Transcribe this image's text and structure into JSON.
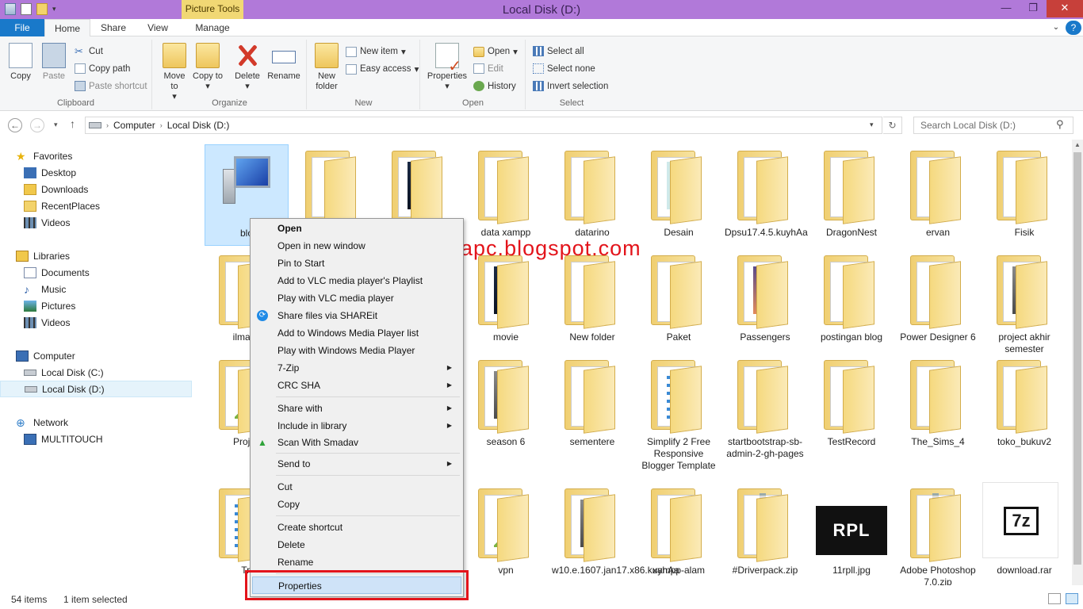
{
  "window": {
    "title": "Local Disk (D:)",
    "context_tab": "Picture Tools"
  },
  "tabs": [
    {
      "label": "File"
    },
    {
      "label": "Home"
    },
    {
      "label": "Share"
    },
    {
      "label": "View"
    },
    {
      "label": "Manage"
    }
  ],
  "ribbon": {
    "clipboard": {
      "label": "Clipboard",
      "copy": "Copy",
      "paste": "Paste",
      "cut": "Cut",
      "copy_path": "Copy path",
      "paste_shortcut": "Paste shortcut"
    },
    "organize": {
      "label": "Organize",
      "move_to": "Move to",
      "copy_to": "Copy to",
      "delete": "Delete",
      "rename": "Rename"
    },
    "new": {
      "label": "New",
      "new_folder": "New folder",
      "new_item": "New item",
      "easy_access": "Easy access"
    },
    "open": {
      "label": "Open",
      "properties": "Properties",
      "open": "Open",
      "edit": "Edit",
      "history": "History"
    },
    "select": {
      "label": "Select",
      "select_all": "Select all",
      "select_none": "Select none",
      "invert": "Invert selection"
    }
  },
  "address": {
    "segments": [
      "Computer",
      "Local Disk (D:)"
    ],
    "search_placeholder": "Search Local Disk (D:)"
  },
  "nav": {
    "favorites": "Favorites",
    "desktop": "Desktop",
    "downloads": "Downloads",
    "recent": "RecentPlaces",
    "videos": "Videos",
    "libraries": "Libraries",
    "documents": "Documents",
    "music": "Music",
    "pictures": "Pictures",
    "videos2": "Videos",
    "computer": "Computer",
    "local_c": "Local Disk (C:)",
    "local_d": "Local Disk (D:)",
    "network": "Network",
    "multitouch": "MULTITOUCH"
  },
  "items": [
    {
      "label": "blo"
    },
    {
      "label": ""
    },
    {
      "label": ""
    },
    {
      "label": "data xampp"
    },
    {
      "label": "datarino"
    },
    {
      "label": "Desain"
    },
    {
      "label": "Dpsu17.4.5.kuyhAa"
    },
    {
      "label": "DragonNest"
    },
    {
      "label": "ervan"
    },
    {
      "label": "Fisik"
    },
    {
      "label": "ilma lu"
    },
    {
      "label": ""
    },
    {
      "label": ""
    },
    {
      "label": "movie"
    },
    {
      "label": "New folder"
    },
    {
      "label": "Paket"
    },
    {
      "label": "Passengers"
    },
    {
      "label": "postingan blog"
    },
    {
      "label": "Power Designer 6"
    },
    {
      "label": "project akhir semester"
    },
    {
      "label": "Projek"
    },
    {
      "label": ""
    },
    {
      "label": ""
    },
    {
      "label": "season 6"
    },
    {
      "label": "sementere"
    },
    {
      "label": "Simplify 2 Free Responsive Blogger Template"
    },
    {
      "label": "startbootstrap-sb-admin-2-gh-pages"
    },
    {
      "label": "TestRecord"
    },
    {
      "label": "The_Sims_4"
    },
    {
      "label": "toko_bukuv2"
    },
    {
      "label": "Tri"
    },
    {
      "label": ""
    },
    {
      "label": ""
    },
    {
      "label": "vpn"
    },
    {
      "label": "w10.e.1607.jan17.x86.kuyhAa"
    },
    {
      "label": "xampp-alam"
    },
    {
      "label": "#Driverpack.zip"
    },
    {
      "label": "11rpll.jpg"
    },
    {
      "label": "Adobe Photoshop 7.0.zip"
    },
    {
      "label": "download.rar"
    }
  ],
  "rpl_text": "RPL",
  "sevenz_text": "7z",
  "menu": {
    "open": "Open",
    "open_new": "Open in new window",
    "pin": "Pin to Start",
    "vlc_add": "Add to VLC media player's Playlist",
    "vlc_play": "Play with VLC media player",
    "shareit": "Share files via SHAREit",
    "wmp_add": "Add to Windows Media Player list",
    "wmp_play": "Play with Windows Media Player",
    "zip7": "7-Zip",
    "crc": "CRC SHA",
    "share_with": "Share with",
    "include": "Include in library",
    "smadav": "Scan With Smadav",
    "send_to": "Send to",
    "cut": "Cut",
    "copy": "Copy",
    "create_shortcut": "Create shortcut",
    "delete": "Delete",
    "rename": "Rename",
    "properties": "Properties"
  },
  "watermark": "beliapc.blogspot.com",
  "status": {
    "count": "54 items",
    "selected": "1 item selected"
  }
}
